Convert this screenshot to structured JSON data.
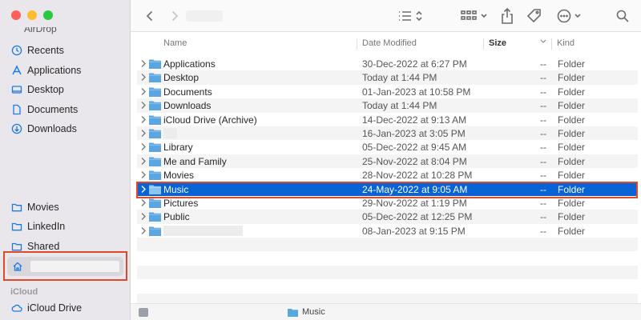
{
  "sidebar": {
    "partial_label": "AirDrop",
    "items": [
      {
        "label": "Recents",
        "icon": "clock-icon"
      },
      {
        "label": "Applications",
        "icon": "applications-icon"
      },
      {
        "label": "Desktop",
        "icon": "desktop-icon"
      },
      {
        "label": "Documents",
        "icon": "document-icon"
      },
      {
        "label": "Downloads",
        "icon": "download-icon"
      }
    ],
    "items_lower": [
      {
        "label": "Movies",
        "icon": "folder-icon"
      },
      {
        "label": "LinkedIn",
        "icon": "folder-icon"
      },
      {
        "label": "Shared",
        "icon": "folder-icon"
      }
    ],
    "home_icon": "home-icon",
    "icloud_section": "iCloud",
    "icloud_drive": "iCloud Drive"
  },
  "columns": {
    "name": "Name",
    "date_modified": "Date Modified",
    "size": "Size",
    "kind": "Kind"
  },
  "rows": [
    {
      "name": "Applications",
      "date": "30-Dec-2022 at 6:27 PM",
      "size": "--",
      "kind": "Folder"
    },
    {
      "name": "Desktop",
      "date": "Today at 1:44 PM",
      "size": "--",
      "kind": "Folder"
    },
    {
      "name": "Documents",
      "date": "01-Jan-2023 at 10:58 PM",
      "size": "--",
      "kind": "Folder"
    },
    {
      "name": "Downloads",
      "date": "Today at 1:44 PM",
      "size": "--",
      "kind": "Folder"
    },
    {
      "name": "iCloud Drive (Archive)",
      "date": "14-Dec-2022 at 9:13 AM",
      "size": "--",
      "kind": "Folder"
    },
    {
      "name": "",
      "date": "16-Jan-2023 at 3:05 PM",
      "size": "--",
      "kind": "Folder"
    },
    {
      "name": "Library",
      "date": "05-Dec-2022 at 9:45 AM",
      "size": "--",
      "kind": "Folder"
    },
    {
      "name": "Me and Family",
      "date": "25-Nov-2022 at 8:04 PM",
      "size": "--",
      "kind": "Folder"
    },
    {
      "name": "Movies",
      "date": "28-Nov-2022 at 10:28 PM",
      "size": "--",
      "kind": "Folder"
    },
    {
      "name": "Music",
      "date": "24-May-2022 at 9:05 AM",
      "size": "--",
      "kind": "Folder",
      "selected": true
    },
    {
      "name": "Pictures",
      "date": "29-Nov-2022 at 1:19 PM",
      "size": "--",
      "kind": "Folder"
    },
    {
      "name": "Public",
      "date": "05-Dec-2022 at 12:25 PM",
      "size": "--",
      "kind": "Folder"
    },
    {
      "name": "",
      "date": "08-Jan-2023 at 9:15 PM",
      "size": "--",
      "kind": "Folder"
    }
  ],
  "statusbar": {
    "path_label": "Music"
  },
  "colors": {
    "selection": "#0863d6",
    "highlight_border": "#e0482a",
    "folder": "#5aa6e0"
  }
}
